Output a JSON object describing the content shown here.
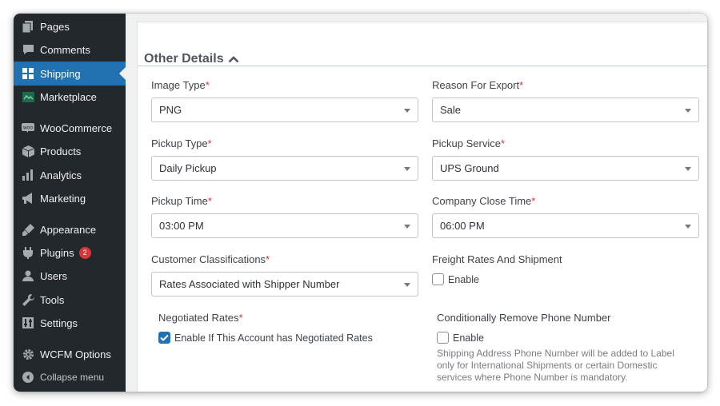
{
  "sidebar": {
    "items": [
      {
        "label": "Pages",
        "icon": "pages-icon"
      },
      {
        "label": "Comments",
        "icon": "comments-icon"
      },
      {
        "label": "Shipping",
        "icon": "shipping-grid-icon",
        "active": true
      },
      {
        "label": "Marketplace",
        "icon": "marketplace-icon"
      },
      {
        "label": "WooCommerce",
        "icon": "woocommerce-icon"
      },
      {
        "label": "Products",
        "icon": "products-icon"
      },
      {
        "label": "Analytics",
        "icon": "analytics-icon"
      },
      {
        "label": "Marketing",
        "icon": "marketing-icon"
      },
      {
        "label": "Appearance",
        "icon": "appearance-icon"
      },
      {
        "label": "Plugins",
        "icon": "plugins-icon",
        "badge": "2"
      },
      {
        "label": "Users",
        "icon": "users-icon"
      },
      {
        "label": "Tools",
        "icon": "tools-icon"
      },
      {
        "label": "Settings",
        "icon": "settings-icon"
      },
      {
        "label": "WCFM Options",
        "icon": "gear-icon"
      },
      {
        "label": "Collapse menu",
        "icon": "collapse-icon"
      }
    ]
  },
  "section": {
    "title": "Other Details",
    "toggle_icon": "chevron-up-icon"
  },
  "fields": {
    "image_type": {
      "label": "Image Type",
      "required": "*",
      "value": "PNG"
    },
    "reason_for_export": {
      "label": "Reason For Export",
      "required": "*",
      "value": "Sale"
    },
    "pickup_type": {
      "label": "Pickup Type",
      "required": "*",
      "value": "Daily Pickup"
    },
    "pickup_service": {
      "label": "Pickup Service",
      "required": "*",
      "value": "UPS Ground"
    },
    "pickup_time": {
      "label": "Pickup Time",
      "required": "*",
      "value": "03:00 PM"
    },
    "company_close_time": {
      "label": "Company Close Time",
      "required": "*",
      "value": "06:00 PM"
    },
    "customer_classifications": {
      "label": "Customer Classifications",
      "required": "*",
      "value": "Rates Associated with Shipper Number"
    },
    "freight_rates": {
      "label": "Freight Rates And Shipment",
      "checkbox_label": "Enable",
      "checked": false
    },
    "negotiated_rates": {
      "label": "Negotiated Rates",
      "required": "*",
      "checkbox_label": "Enable If This Account has Negotiated Rates",
      "checked": true
    },
    "remove_phone": {
      "label": "Conditionally Remove Phone Number",
      "checkbox_label": "Enable",
      "checked": false,
      "help_lines": [
        "Shipping Address Phone Number will be added to Label",
        "only for International Shipments or certain Domestic",
        "services where Phone Number is mandatory."
      ]
    }
  },
  "colors": {
    "sidebar_bg": "#23282d",
    "active_bg": "#2271b1",
    "required": "#d63638",
    "checkbox_checked": "#2271b1"
  }
}
